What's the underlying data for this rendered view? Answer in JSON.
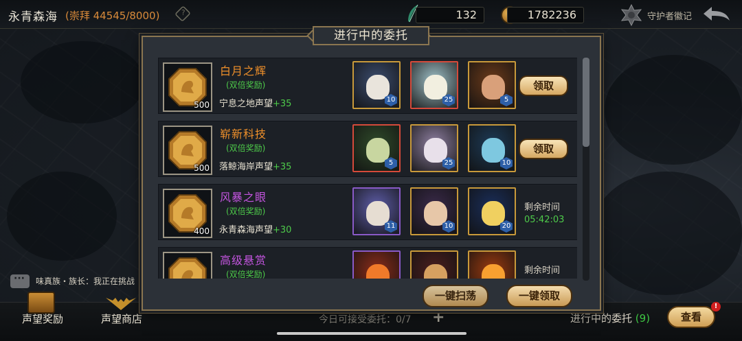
{
  "header": {
    "region_title": "永青森海",
    "worship_text": "(崇拜 44545/8000)",
    "help_icon": "question-diamond-icon",
    "resource_feather_value": "132",
    "resource_gold_value": "1782236",
    "guardian_badge_label": "守护者徽记",
    "back_icon": "back-arrow-icon"
  },
  "chat": {
    "text": "味真族・族长：我正在挑战"
  },
  "bottom_bar": {
    "reward_label": "声望奖励",
    "shop_label": "声望商店",
    "daily_text": "今日可接受委托：0/7",
    "ongoing_label": "进行中的委托",
    "ongoing_count": "(9)",
    "view_label": "查看",
    "alert_badge": "!"
  },
  "modal": {
    "title": "进行中的委托",
    "sweep_label": "一键扫荡",
    "claim_all_label": "一键领取",
    "tasks": [
      {
        "name": "白月之辉",
        "name_color": "#f0902a",
        "double": "(双倍奖励)",
        "reward_amount": "500",
        "fame_text": "宁息之地声望",
        "fame_plus": "+35",
        "heroes": [
          {
            "level": "10",
            "frame": "#c99a3a",
            "bg": "#3b4c6e",
            "face": "#e9e4dc"
          },
          {
            "level": "25",
            "frame": "#d64a3a",
            "bg": "#9fc0c7",
            "face": "#f2efe0"
          },
          {
            "level": "5",
            "frame": "#c99a3a",
            "bg": "#6b3a1a",
            "face": "#d9a07a"
          }
        ],
        "action": "领取"
      },
      {
        "name": "崭新科技",
        "name_color": "#f0902a",
        "double": "(双倍奖励)",
        "reward_amount": "500",
        "fame_text": "落鲸海岸声望",
        "fame_plus": "+35",
        "heroes": [
          {
            "level": "5",
            "frame": "#d64a3a",
            "bg": "#2f4a2a",
            "face": "#c8d6a0"
          },
          {
            "level": "25",
            "frame": "#c99a3a",
            "bg": "#8e7fa0",
            "face": "#e8e0ea"
          },
          {
            "level": "10",
            "frame": "#c99a3a",
            "bg": "#1d3a56",
            "face": "#7ec8e0"
          }
        ],
        "action": "领取"
      },
      {
        "name": "风暴之眼",
        "name_color": "#c455e0",
        "double": "(双倍奖励)",
        "reward_amount": "400",
        "fame_text": "永青森海声望",
        "fame_plus": "+30",
        "heroes": [
          {
            "level": "11",
            "frame": "#8a5ac8",
            "bg": "#5e5da8",
            "face": "#e6ddd2"
          },
          {
            "level": "10",
            "frame": "#c99a3a",
            "bg": "#3a2a4a",
            "face": "#e7c7a8"
          },
          {
            "level": "20",
            "frame": "#c99a3a",
            "bg": "#1a2e5a",
            "face": "#f0d060"
          }
        ],
        "remain_label": "剩余时间",
        "remain_time": "05:42:03"
      },
      {
        "name": "高级悬赏",
        "name_color": "#c455e0",
        "double": "(双倍奖励)",
        "reward_amount": "",
        "fame_text": "",
        "fame_plus": "",
        "heroes": [
          {
            "level": "",
            "frame": "#8a5ac8",
            "bg": "#8a2c1a",
            "face": "#f07a2a"
          },
          {
            "level": "",
            "frame": "#c99a3a",
            "bg": "#4a1e1e",
            "face": "#d6a060"
          },
          {
            "level": "",
            "frame": "#c99a3a",
            "bg": "#9a3a10",
            "face": "#f8a030"
          }
        ],
        "remain_label": "剩余时间",
        "remain_time": ""
      }
    ]
  }
}
